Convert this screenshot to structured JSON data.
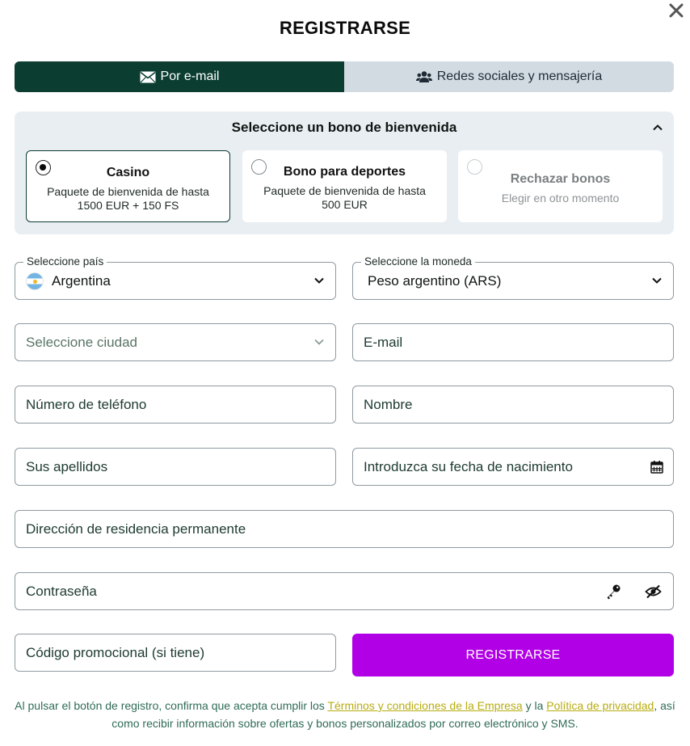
{
  "dialog": {
    "title": "REGISTRARSE"
  },
  "tabs": [
    {
      "label": "Por e-mail",
      "icon": "envelope-icon",
      "active": true
    },
    {
      "label": "Redes sociales y mensajería",
      "icon": "users-icon",
      "active": false
    }
  ],
  "bonus": {
    "heading": "Seleccione un bono de bienvenida",
    "options": [
      {
        "name": "Casino",
        "desc": "Paquete de bienvenida de hasta 1500 EUR + 150 FS",
        "selected": true
      },
      {
        "name": "Bono para deportes",
        "desc": "Paquete de bienvenida de hasta 500 EUR",
        "selected": false
      },
      {
        "name": "Rechazar bonos",
        "desc": "Elegir en otro momento",
        "selected": false
      }
    ]
  },
  "form": {
    "country_label": "Seleccione país",
    "country_value": "Argentina",
    "currency_label": "Seleccione la moneda",
    "currency_value": "Peso argentino (ARS)",
    "city_placeholder": "Seleccione ciudad",
    "email_placeholder": "E-mail",
    "phone_placeholder": "Número de teléfono",
    "name_placeholder": "Nombre",
    "surname_placeholder": "Sus apellidos",
    "birthdate_placeholder": "Introduzca su fecha de nacimiento",
    "address_placeholder": "Dirección de residencia permanente",
    "password_placeholder": "Contraseña",
    "promo_placeholder": "Código promocional (si tiene)",
    "submit_label": "REGISTRARSE"
  },
  "legal": {
    "text_1": "Al pulsar el botón de registro, confirma que acepta cumplir los",
    "terms_link": "Términos y condiciones de la Empresa",
    "text_2": "y la",
    "privacy_link": "Política de privacidad",
    "text_3": ", así como recibir información sobre ofertas y bonos personalizados por correo electrónico y SMS."
  },
  "colors": {
    "active_tab": "#0b3d31",
    "submit_button": "#b100e6",
    "link": "#b8ac10"
  }
}
